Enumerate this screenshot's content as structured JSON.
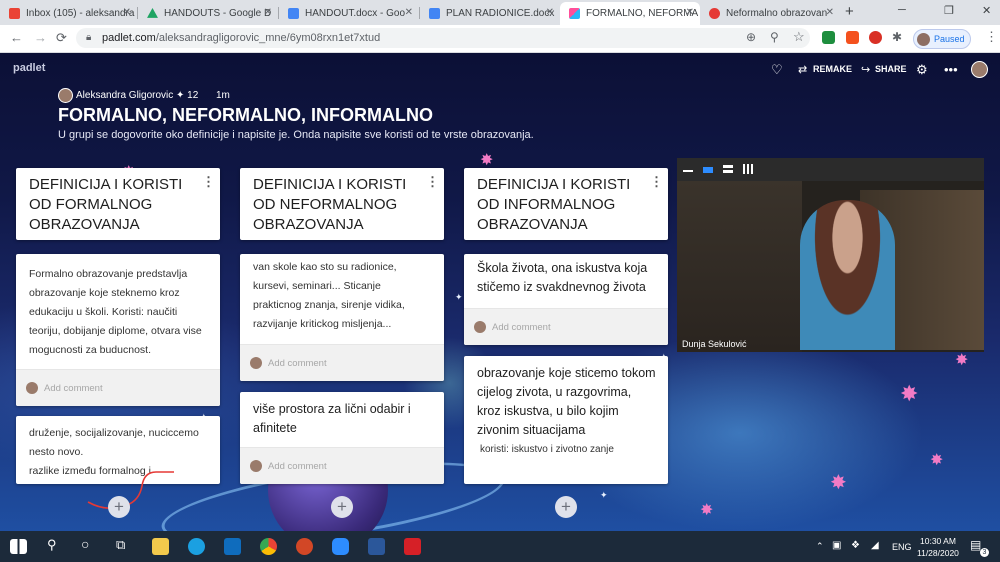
{
  "browser": {
    "tabs": [
      {
        "title": "Inbox (105) - aleksandra",
        "icon": "gmail-icon",
        "color": "#ea4335"
      },
      {
        "title": "HANDOUTS - Google D",
        "icon": "google-drive-icon",
        "color": "#1fa463"
      },
      {
        "title": "HANDOUT.docx - Goo",
        "icon": "google-docs-icon",
        "color": "#4285f4"
      },
      {
        "title": "PLAN RADIONICE.docx",
        "icon": "google-docs-icon",
        "color": "#4285f4"
      },
      {
        "title": "FORMALNO, NEFORMA",
        "icon": "padlet-icon",
        "color": "#d63384"
      },
      {
        "title": "Neformalno obrazovan",
        "icon": "chrome-web-icon",
        "color": "#e53935"
      }
    ],
    "url_host": "padlet.com",
    "url_path": "/aleksandragligorovic_mne/6ym08rxn1et7xtud",
    "paused_label": "Paused"
  },
  "padlet": {
    "brand": "padlet",
    "remake_label": "REMAKE",
    "share_label": "SHARE",
    "author": "Aleksandra Gligorovic",
    "likes": "✦ 12",
    "age": "1m",
    "title": "FORMALNO, NEFORMALNO, INFORMALNO",
    "description": "U grupi se dogovorite oko definicije i napisite je. Onda napisite sve koristi od te vrste obrazovanja.",
    "add_comment": "Add comment",
    "columns": [
      {
        "heading": "DEFINICIJA I KORISTI OD FORMALNOG OBRAZOVANJA",
        "posts": [
          {
            "text": "Formalno obrazovanje predstavlja obrazovanje koje steknemo kroz edukaciju u školi. Koristi: naučiti teoriju, dobijanje diplome, otvara vise mogucnosti za buducnost."
          },
          {
            "line1": "druženje, socijalizovanje, nuciccemo nesto novo.",
            "line2": "razlike između formalnog i"
          }
        ]
      },
      {
        "heading": "DEFINICIJA I KORISTI OD NEFORMALNOG OBRAZOVANJA",
        "posts": [
          {
            "text": "van skole kao sto su radionice, kursevi, seminari... Sticanje prakticnog znanja, sirenje vidika, razvijanje kritickog misljenja..."
          },
          {
            "text": "više prostora za lični odabir i afinitete"
          }
        ]
      },
      {
        "heading": "DEFINICIJA I KORISTI OD INFORMALNOG OBRAZOVANJA",
        "posts": [
          {
            "text": "Škola života, ona iskustva koja stičemo iz svakdnevnog života"
          },
          {
            "text": "obrazovanje koje sticemo tokom cijelog zivota, u razgovrima, kroz iskustva, u bilo kojim zivonim situacijama",
            "sub": "koristi: iskustvo i zivotno zanje"
          }
        ]
      }
    ]
  },
  "video": {
    "participant": "Dunja Sekulović"
  },
  "taskbar": {
    "apps": [
      "windows-start-icon",
      "search-icon",
      "cortana-icon",
      "task-view-icon",
      "file-explorer-icon",
      "edge-icon",
      "outlook-icon",
      "chrome-icon",
      "powerpoint-icon",
      "zoom-icon",
      "word-icon",
      "acrobat-icon"
    ],
    "lang": "ENG",
    "time": "10:30 AM",
    "date": "11/28/2020",
    "notif_count": "3"
  }
}
